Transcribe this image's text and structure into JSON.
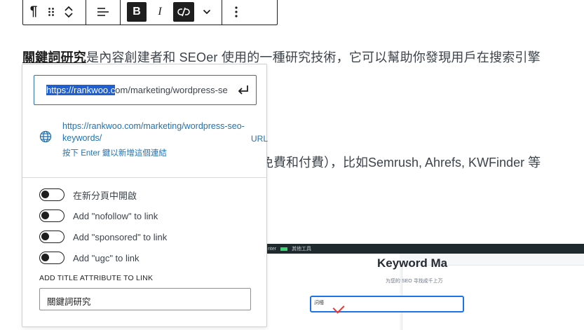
{
  "toolbar": {
    "paragraph_glyph": "¶",
    "bold_label": "B",
    "italic_label": "I"
  },
  "content": {
    "line1_link": "關鍵詞研究",
    "line1_rest": "是內容創建者和 SEOer 使用的一種研究技術，它可以幫助你發現用戶在搜索引擎",
    "line2": "免費和付費），比如Semrush, Ahrefs, KWFinder 等"
  },
  "link_popover": {
    "url_selected": "https://rankwoo.c",
    "url_rest": "om/marketing/wordpress-se",
    "suggestion": {
      "url": "https://rankwoo.com/marketing/wordpress-seo-keywords/",
      "hint": "按下 Enter 鍵以新增這個連結",
      "type": "URL"
    },
    "toggles": [
      {
        "label": "在新分頁中開啟",
        "on": false
      },
      {
        "label": "Add \"nofollow\" to link",
        "on": false
      },
      {
        "label": "Add \"sponsored\" to link",
        "on": false
      },
      {
        "label": "Add \"ugc\" to link",
        "on": false
      }
    ],
    "title_attr_label": "ADD TITLE ATTRIBUTE TO LINK",
    "title_attr_value": "關鍵詞研究"
  },
  "embed_image": {
    "topbar_text1": "nter",
    "topbar_text2": "其他工具",
    "title": "Keyword Ma",
    "subtitle": "为您的 SEO 寻找成千上万",
    "input_text": "詞種"
  },
  "colors": {
    "link_blue": "#2271b1",
    "focus_border": "#2f6fa6",
    "selection": "#1f5fd0",
    "dark": "#1e1e1e"
  }
}
